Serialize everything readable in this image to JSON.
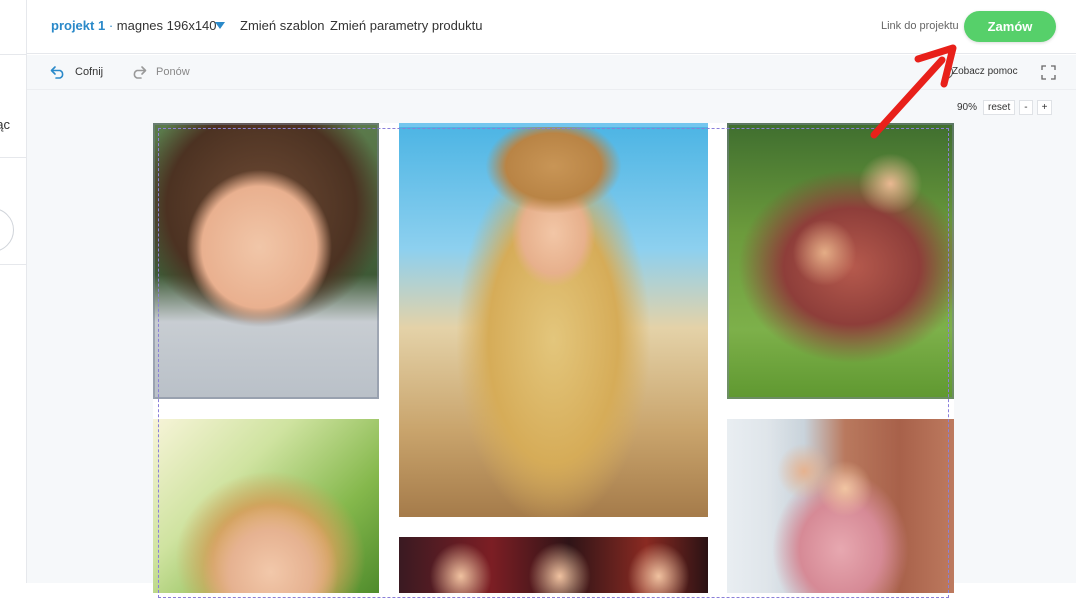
{
  "sidebar": {
    "partial_text": "ąc"
  },
  "header": {
    "project_name": "projekt 1",
    "separator": "·",
    "product": "magnes 196x140",
    "change_template": "Zmień szablon",
    "change_params": "Zmień parametry produktu",
    "project_link": "Link do projektu",
    "order_button": "Zamów",
    "accent_color": "#2a89c9",
    "order_color": "#56d06a"
  },
  "toolbar": {
    "undo": "Cofnij",
    "redo": "Ponów",
    "help": "Zobacz pomoc"
  },
  "zoom": {
    "level": "90%",
    "reset": "reset",
    "minus": "-",
    "plus": "+"
  },
  "annotation": {
    "arrow_color": "#e8201a"
  }
}
